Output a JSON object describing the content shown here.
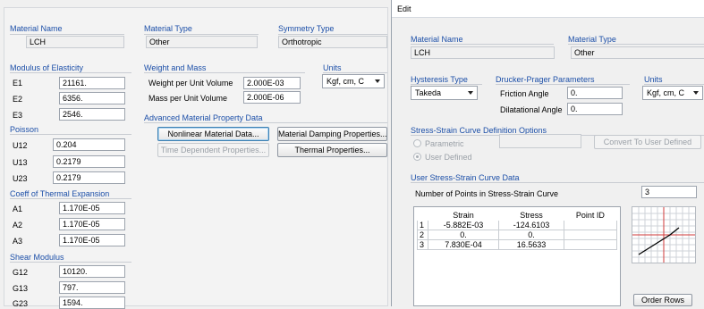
{
  "left": {
    "material_name": {
      "title": "Material Name",
      "value": "LCH"
    },
    "material_type": {
      "title": "Material Type",
      "value": "Other"
    },
    "symmetry_type": {
      "title": "Symmetry Type",
      "value": "Orthotropic"
    },
    "modulus": {
      "title": "Modulus of Elasticity",
      "rows": [
        {
          "label": "E1",
          "value": "21161."
        },
        {
          "label": "E2",
          "value": "6356."
        },
        {
          "label": "E3",
          "value": "2546."
        }
      ]
    },
    "weight_mass": {
      "title": "Weight and Mass",
      "weight_label": "Weight per Unit Volume",
      "weight_value": "2.000E-03",
      "mass_label": "Mass per Unit Volume",
      "mass_value": "2.000E-06"
    },
    "units": {
      "title": "Units",
      "value": "Kgf, cm, C"
    },
    "advanced": {
      "title": "Advanced Material Property Data",
      "nonlinear": "Nonlinear Material Data...",
      "damping": "Material Damping Properties...",
      "time_dependent": "Time Dependent Properties...",
      "thermal": "Thermal Properties..."
    },
    "poisson": {
      "title": "Poisson",
      "rows": [
        {
          "label": "U12",
          "value": "0.204"
        },
        {
          "label": "U13",
          "value": "0.2179"
        },
        {
          "label": "U23",
          "value": "0.2179"
        }
      ]
    },
    "thermal_exp": {
      "title": "Coeff of Thermal Expansion",
      "rows": [
        {
          "label": "A1",
          "value": "1.170E-05"
        },
        {
          "label": "A2",
          "value": "1.170E-05"
        },
        {
          "label": "A3",
          "value": "1.170E-05"
        }
      ]
    },
    "shear": {
      "title": "Shear Modulus",
      "rows": [
        {
          "label": "G12",
          "value": "10120."
        },
        {
          "label": "G13",
          "value": "797."
        },
        {
          "label": "G23",
          "value": "1594."
        }
      ]
    }
  },
  "dialog": {
    "title": "Edit",
    "material_name": {
      "title": "Material Name",
      "value": "LCH"
    },
    "material_type": {
      "title": "Material Type",
      "value": "Other"
    },
    "hysteresis": {
      "title": "Hysteresis Type",
      "value": "Takeda"
    },
    "drucker": {
      "title": "Drucker-Prager Parameters",
      "friction_label": "Friction Angle",
      "friction_value": "0.",
      "dilatational_label": "Dilatational Angle",
      "dilatational_value": "0."
    },
    "units": {
      "title": "Units",
      "value": "Kgf, cm, C"
    },
    "curve_options": {
      "title": "Stress-Strain Curve Definition Options",
      "parametric": "Parametric",
      "user_defined": "User Defined",
      "convert_button": "Convert To User Defined"
    },
    "user_curve": {
      "title": "User Stress-Strain Curve Data",
      "num_points_label": "Number of Points in Stress-Strain Curve",
      "num_points_value": "3"
    },
    "table": {
      "headers": [
        "Strain",
        "Stress",
        "Point ID"
      ],
      "rows": [
        {
          "idx": "1",
          "strain": "-5.882E-03",
          "stress": "-124.6103",
          "point": ""
        },
        {
          "idx": "2",
          "strain": "0.",
          "stress": "0.",
          "point": ""
        },
        {
          "idx": "3",
          "strain": "7.830E-04",
          "stress": "16.5633",
          "point": ""
        }
      ]
    },
    "order_rows": "Order Rows"
  }
}
